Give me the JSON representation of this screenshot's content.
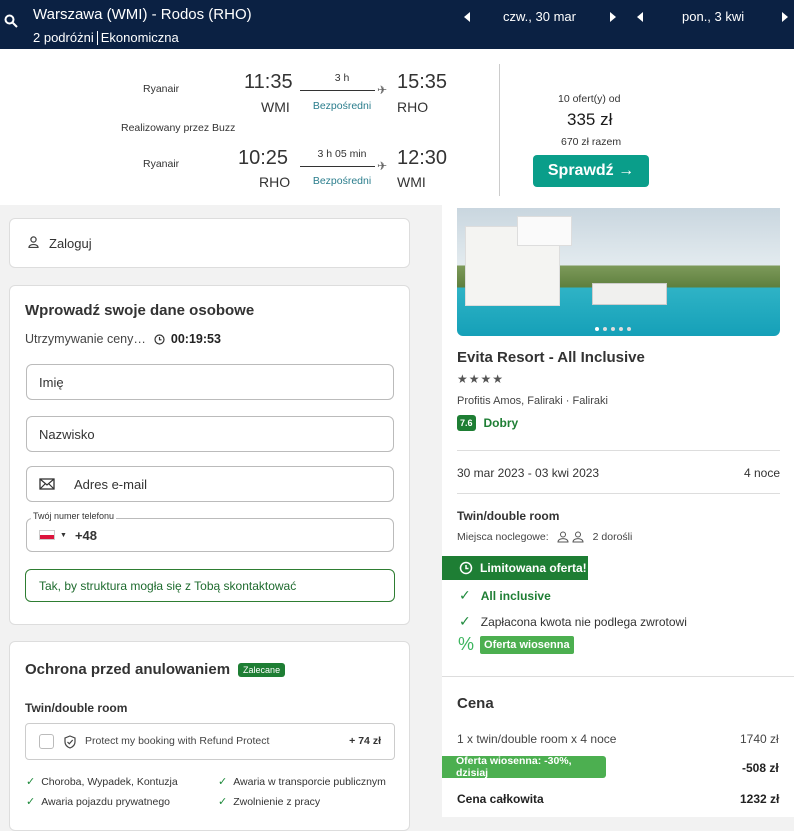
{
  "header": {
    "route": "Warszawa (WMI) - Rodos (RHO)",
    "travellers": "2 podróżni",
    "cabin": "Ekonomiczna",
    "date_out": "czw., 30 mar",
    "date_ret": "pon., 3 kwi"
  },
  "outbound": {
    "airline": "Ryanair",
    "dep_time": "11:35",
    "dep_code": "WMI",
    "duration": "3 h",
    "stops": "Bezpośredni",
    "arr_time": "15:35",
    "arr_code": "RHO"
  },
  "operated_by": "Realizowany przez Buzz",
  "inbound": {
    "airline": "Ryanair",
    "dep_time": "10:25",
    "dep_code": "RHO",
    "duration": "3 h 05 min",
    "stops": "Bezpośredni",
    "arr_time": "12:30",
    "arr_code": "WMI"
  },
  "offer": {
    "count": "10 ofert(y) od",
    "price": "335 zł",
    "total": "670 zł razem",
    "button": "Sprawdź →"
  },
  "login": {
    "label": "Zaloguj"
  },
  "personal": {
    "title": "Wprowadź swoje dane osobowe",
    "hold_label": "Utrzymywanie ceny…",
    "timer": "00:19:53",
    "first_name": "Imię",
    "last_name": "Nazwisko",
    "email": "Adres e-mail",
    "phone_label": "Twój numer telefonu",
    "phone_prefix": "+48",
    "tooltip": "Tak, by struktura mogła się z Tobą skontaktować"
  },
  "cancel": {
    "title": "Ochrona przed anulowaniem",
    "badge": "Zalecane",
    "room": "Twin/double room",
    "protect": "Protect my booking with Refund Protect",
    "protect_price": "+ 74 zł",
    "features": [
      "Choroba, Wypadek, Kontuzja",
      "Awaria w transporcie publicznym",
      "Awaria pojazdu prywatnego",
      "Zwolnienie z pracy"
    ]
  },
  "hotel": {
    "name": "Evita Resort - All Inclusive",
    "stars": "★★★★",
    "location": "Profitis Amos, Faliraki · Faliraki",
    "score": "7.6",
    "score_label": "Dobry",
    "dates": "30 mar 2023 - 03 kwi 2023",
    "nights": "4 noce",
    "room": "Twin/double room",
    "beds_label": "Miejsca noclegowe:",
    "guests": "2 dorośli",
    "limited": "Limitowana oferta!",
    "inclusive": "All inclusive",
    "nonrefund": "Zapłacona kwota nie podlega zwrotowi",
    "spring": "Oferta wiosenna"
  },
  "price": {
    "title": "Cena",
    "line1_label": "1 x twin/double room x 4 noce",
    "line1_value": "1740 zł",
    "discount_label": "Oferta wiosenna: -30%, dzisiaj",
    "discount_value": "-508 zł",
    "total_label": "Cena całkowita",
    "total_value": "1232 zł"
  },
  "colors": {
    "header": "#0b2143",
    "accent": "#0a9e8a",
    "green": "#1e7e34"
  }
}
